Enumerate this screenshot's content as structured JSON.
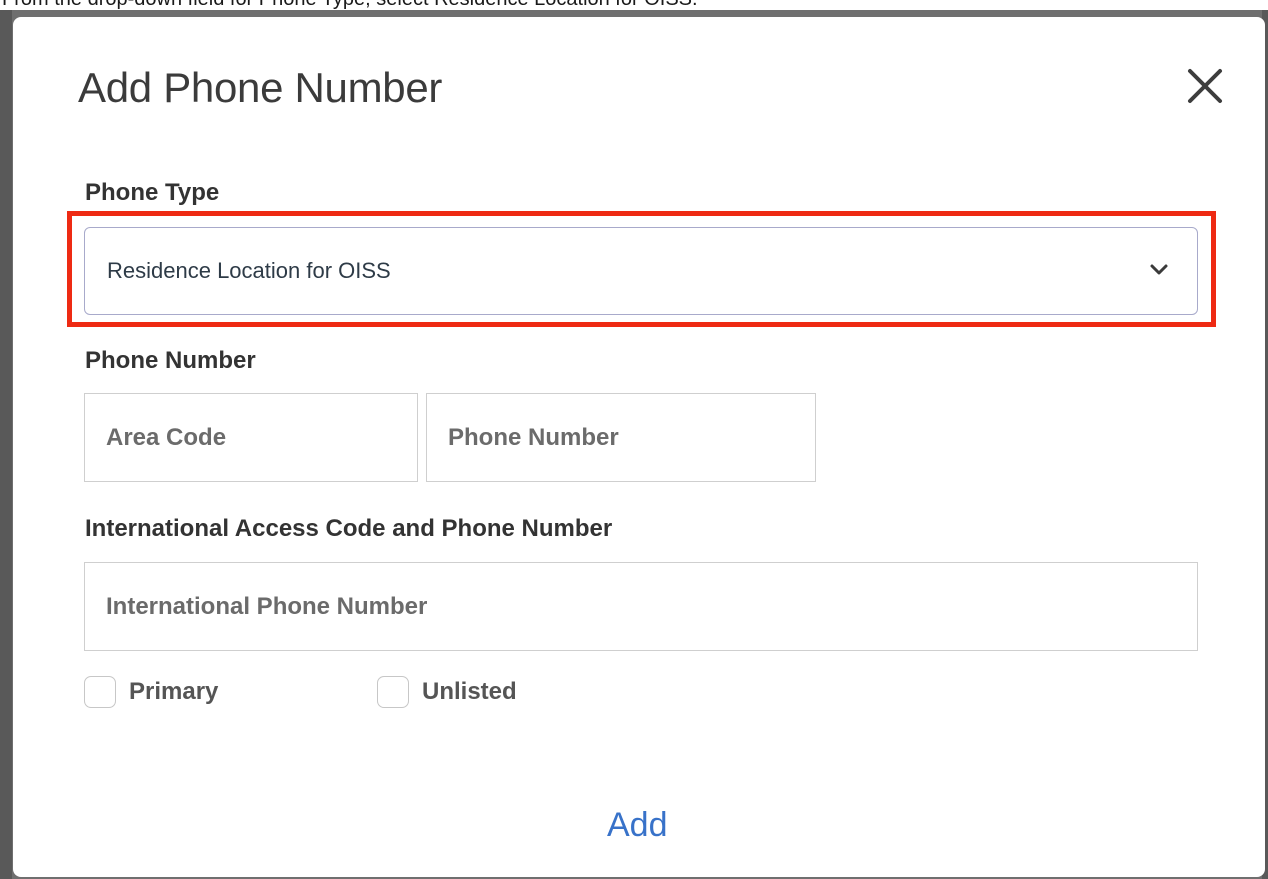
{
  "instruction": {
    "text": "From the drop-down field for Phone Type, select Residence Location for OISS."
  },
  "dialog": {
    "title": "Add Phone Number",
    "close_icon": "close-icon"
  },
  "phone_type": {
    "label": "Phone Type",
    "selected_value": "Residence Location for OISS",
    "chevron_icon": "chevron-down-icon"
  },
  "phone_number": {
    "label": "Phone Number",
    "area_code_placeholder": "Area Code",
    "number_placeholder": "Phone Number"
  },
  "international": {
    "label": "International Access Code and Phone Number",
    "placeholder": "International Phone Number"
  },
  "checkboxes": {
    "primary": {
      "label": "Primary",
      "checked": false
    },
    "unlisted": {
      "label": "Unlisted",
      "checked": false
    }
  },
  "actions": {
    "add_label": "Add"
  },
  "colors": {
    "highlight": "#ee2a13",
    "link": "#3872c9",
    "backdrop": "#6f6f6f"
  }
}
